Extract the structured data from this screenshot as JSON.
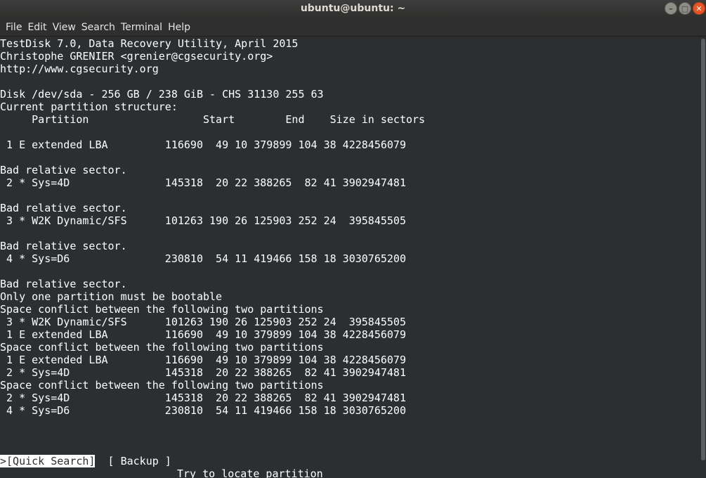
{
  "window": {
    "title": "ubuntu@ubuntu: ~"
  },
  "menubar": {
    "items": [
      "File",
      "Edit",
      "View",
      "Search",
      "Terminal",
      "Help"
    ]
  },
  "terminal": {
    "header": [
      "TestDisk 7.0, Data Recovery Utility, April 2015",
      "Christophe GRENIER <grenier@cgsecurity.org>",
      "http://www.cgsecurity.org"
    ],
    "disk": "Disk /dev/sda - 256 GB / 238 GiB - CHS 31130 255 63",
    "current_structure": "Current partition structure:",
    "columns": "     Partition                  Start        End    Size in sectors",
    "entries": [
      {
        "row": " 1 E extended LBA         116690  49 10 379899 104 38 4228456079"
      },
      {
        "msg": "Bad relative sector.",
        "row": " 2 * Sys=4D               145318  20 22 388265  82 41 3902947481"
      },
      {
        "msg": "Bad relative sector.",
        "row": " 3 * W2K Dynamic/SFS      101263 190 26 125903 252 24  395845505"
      },
      {
        "msg": "Bad relative sector.",
        "row": " 4 * Sys=D6               230810  54 11 419466 158 18 3030765200"
      }
    ],
    "trailing_msg": "Bad relative sector.",
    "bootable_msg": "Only one partition must be bootable",
    "conflicts": [
      {
        "heading": "Space conflict between the following two partitions",
        "rows": [
          " 3 * W2K Dynamic/SFS      101263 190 26 125903 252 24  395845505",
          " 1 E extended LBA         116690  49 10 379899 104 38 4228456079"
        ]
      },
      {
        "heading": "Space conflict between the following two partitions",
        "rows": [
          " 1 E extended LBA         116690  49 10 379899 104 38 4228456079",
          " 2 * Sys=4D               145318  20 22 388265  82 41 3902947481"
        ]
      },
      {
        "heading": "Space conflict between the following two partitions",
        "rows": [
          " 2 * Sys=4D               145318  20 22 388265  82 41 3902947481",
          " 4 * Sys=D6               230810  54 11 419466 158 18 3030765200"
        ]
      }
    ],
    "actions": {
      "cursor": ">",
      "quick_search": "[Quick Search]",
      "backup": "[ Backup ]"
    },
    "hint": "Try to locate partition"
  }
}
